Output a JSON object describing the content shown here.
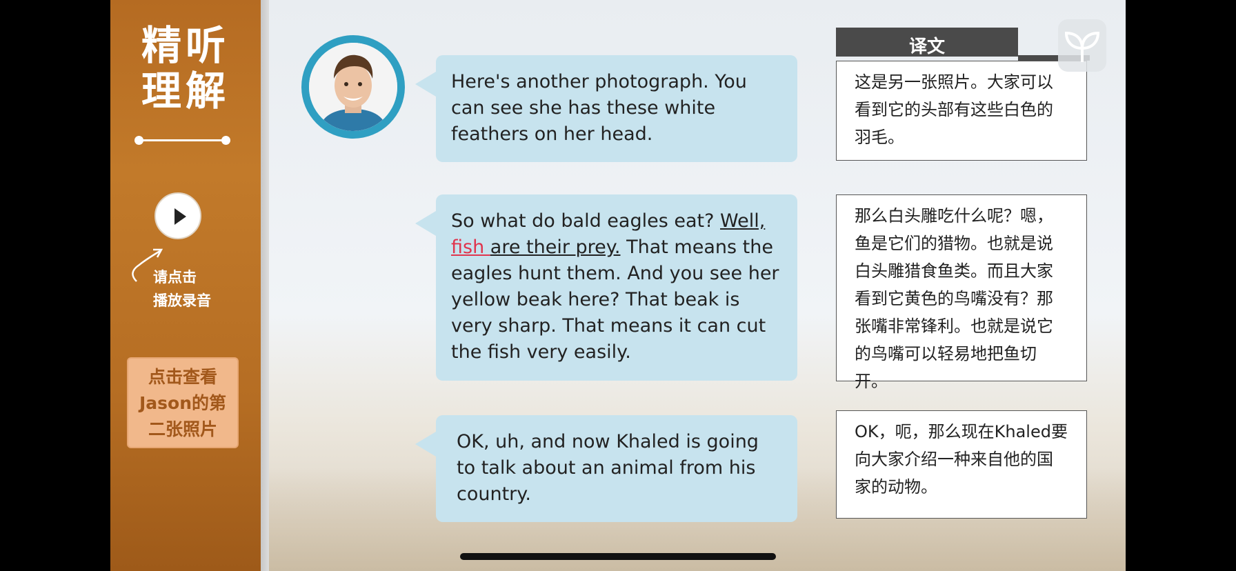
{
  "sidebar": {
    "title_line1": "精听",
    "title_line2": "理解",
    "play_hint_line1": "请点击",
    "play_hint_line2": "播放录音",
    "view_photo_line1": "点击查看",
    "view_photo_line2": "Jason的第",
    "view_photo_line3": "二张照片"
  },
  "translation_header": "译文",
  "dialogue": [
    {
      "text": "Here's another photograph. You can see she has these white feathers on her head.",
      "translation": "这是另一张照片。大家可以看到它的头部有这些白色的羽毛。"
    },
    {
      "text_before": "So what do bald eagles eat? ",
      "underlined_1": "Well, ",
      "highlighted": "fish ",
      "underlined_2": "are their prey.",
      "text_after": " That means the eagles hunt them. And you see her yellow beak here? That beak is very sharp. That means it can cut the fish very easily.",
      "translation": "那么白头雕吃什么呢？嗯，鱼是它们的猎物。也就是说白头雕猎食鱼类。而且大家看到它黄色的鸟嘴没有？那张嘴非常锋利。也就是说它的鸟嘴可以轻易地把鱼切开。"
    },
    {
      "text": "OK, uh, and now Khaled is going to talk about an animal from his country.",
      "translation": "OK，呃，那么现在Khaled要向大家介绍一种来自他的国家的动物。"
    }
  ],
  "icons": {
    "play": "play-icon",
    "hint_arrow": "curved-arrow-icon",
    "avatar": "speaker-avatar",
    "logo": "sprout-logo-icon"
  },
  "colors": {
    "sidebar": "#b8702a",
    "bubble": "#c7e3ee",
    "highlight": "#e0344d",
    "avatar_ring": "#2f9fc2",
    "button": "#f1b88b"
  }
}
